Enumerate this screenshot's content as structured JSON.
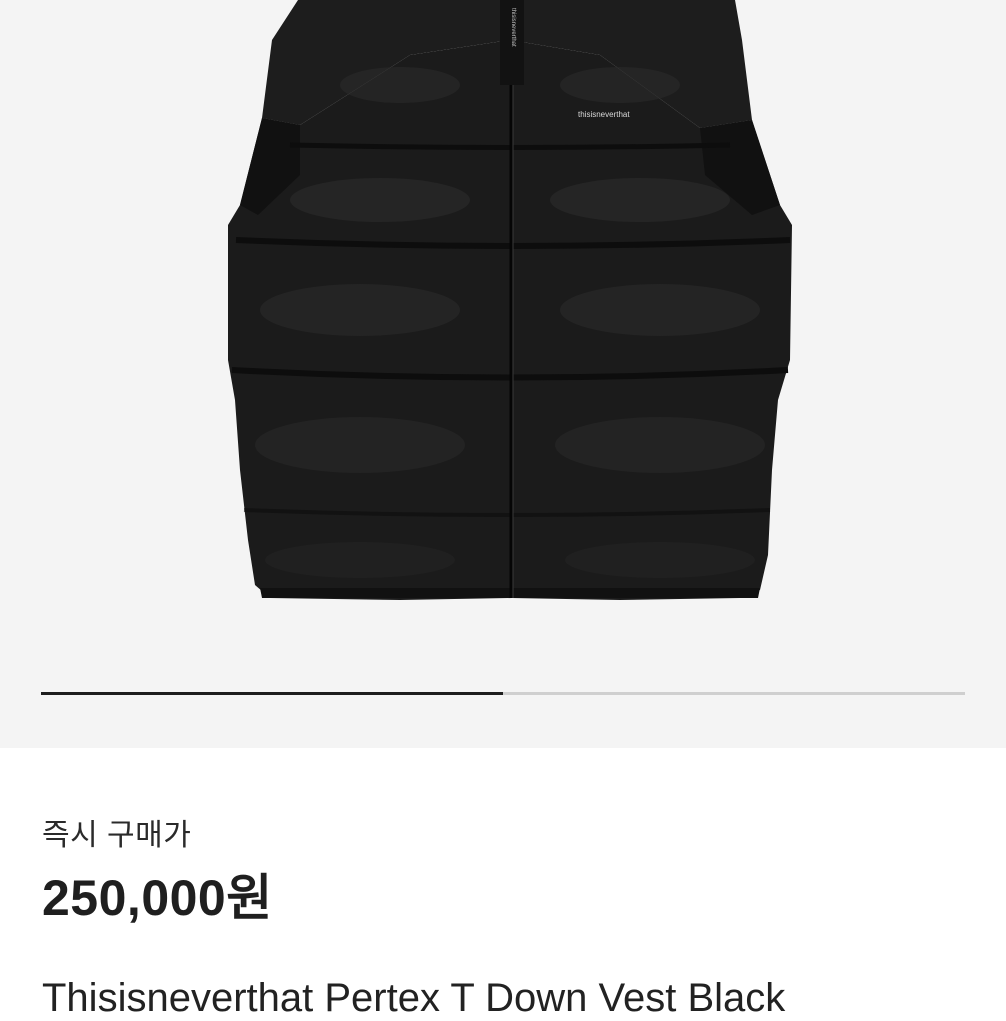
{
  "gallery": {
    "image_alt": "product-photo-black-down-vest",
    "brand_mark": "thisisneverthat",
    "collar_tag": "thisisneverthat",
    "progress_fraction": 0.5
  },
  "product": {
    "price_label": "즉시 구매가",
    "price": "250,000원",
    "title": "Thisisneverthat Pertex T Down Vest Black"
  },
  "colors": {
    "gallery_bg": "#f4f4f4",
    "vest": "#1b1b1b",
    "progress_active": "#1d1d1d",
    "progress_track": "#cfcfcf"
  }
}
